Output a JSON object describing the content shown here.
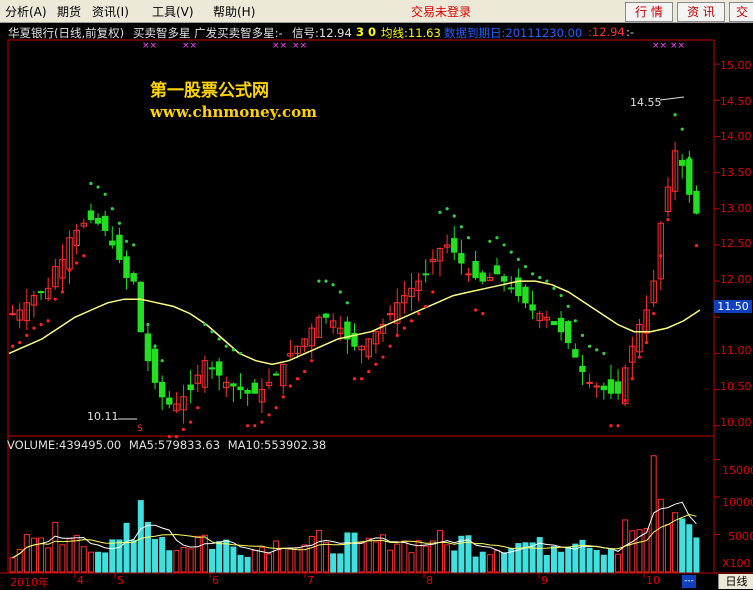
{
  "menu": {
    "items": [
      {
        "label": "分析(A)",
        "name": "menu-analysis"
      },
      {
        "label": "期货",
        "name": "menu-futures"
      },
      {
        "label": "资讯(I)",
        "name": "menu-info"
      },
      {
        "label": "工具(V)",
        "name": "menu-tools"
      },
      {
        "label": "帮助(H)",
        "name": "menu-help"
      }
    ],
    "trade_status": "交易未登录",
    "buttons": {
      "quotes": "行 情",
      "news": "资 讯",
      "trade": "交"
    }
  },
  "chart_header": {
    "stock": "华夏银行(日线,前复权)",
    "indicator": "买卖智多星  广发买卖智多星:-",
    "signal": "信号:12.94",
    "signal_flag": "3 0",
    "ma_line": "均线:11.63",
    "data_date": "数据到期日:20111230.00",
    "last_value": ":12.94",
    "tail": ":-",
    "marks": [
      "××",
      "××",
      "××",
      "××",
      "××",
      "××"
    ]
  },
  "watermark": {
    "title": "第一股票公式网",
    "url": "www.chnmoney.com"
  },
  "annotations": {
    "high": "14.55",
    "low": "10.11",
    "low_marker": "S"
  },
  "price_axis": {
    "ticks": [
      "15.00",
      "14.50",
      "14.00",
      "13.50",
      "13.00",
      "12.50",
      "12.00",
      "11.50",
      "11.00",
      "10.50",
      "10.00"
    ],
    "current": "11.50"
  },
  "volume_header": {
    "volume": "VOLUME:439495.00",
    "ma5": "MA5:579833.63",
    "ma10": "MA10:553902.38"
  },
  "volume_axis": {
    "ticks": [
      "15000",
      "10000",
      "5000"
    ],
    "unit": "X100"
  },
  "time_axis": {
    "labels": [
      "2010年",
      "4",
      "5",
      "6",
      "7",
      "8",
      "9",
      "10"
    ],
    "period_button": "日线",
    "end_marker": "---"
  },
  "colors": {
    "up": "#ff3030",
    "down": "#20e020",
    "ma": "#ffff80",
    "signal_up": "#ff2020",
    "signal_down": "#30d040",
    "axis": "#c00000",
    "accent": "#ffd400"
  },
  "chart_data": {
    "type": "candlestick",
    "price_range": [
      9.9,
      15.25
    ],
    "highlighted_high": 14.55,
    "highlighted_low": 10.11,
    "closes": [
      11.55,
      11.6,
      11.7,
      11.8,
      11.85,
      11.9,
      12.2,
      12.3,
      12.6,
      12.7,
      12.8,
      12.85,
      12.8,
      12.7,
      12.5,
      12.3,
      12.05,
      12.0,
      11.3,
      10.9,
      10.6,
      10.4,
      10.3,
      10.3,
      10.4,
      10.5,
      10.7,
      10.9,
      10.8,
      10.7,
      10.6,
      10.55,
      10.5,
      10.45,
      10.45,
      10.5,
      10.6,
      10.7,
      10.85,
      11.0,
      11.1,
      11.2,
      11.35,
      11.5,
      11.5,
      11.45,
      11.35,
      11.2,
      11.1,
      11.1,
      11.2,
      11.3,
      11.4,
      11.55,
      11.7,
      11.8,
      11.9,
      12.0,
      12.1,
      12.3,
      12.45,
      12.5,
      12.4,
      12.25,
      12.1,
      12.05,
      12.0,
      12.05,
      12.1,
      12.0,
      11.9,
      11.8,
      11.7,
      11.6,
      11.55,
      11.5,
      11.4,
      11.3,
      11.15,
      10.95,
      10.75,
      10.6,
      10.55,
      10.5,
      10.45,
      10.45,
      10.8,
      11.1,
      11.4,
      11.6,
      12.0,
      12.8,
      13.3,
      13.8,
      13.6,
      13.2,
      12.94
    ],
    "ma": [
      11.0,
      11.1,
      11.2,
      11.35,
      11.5,
      11.6,
      11.7,
      11.75,
      11.75,
      11.7,
      11.65,
      11.55,
      11.4,
      11.2,
      11.0,
      10.9,
      10.85,
      10.9,
      11.0,
      11.1,
      11.2,
      11.25,
      11.3,
      11.4,
      11.5,
      11.6,
      11.7,
      11.8,
      11.85,
      11.9,
      11.95,
      12.0,
      12.0,
      11.95,
      11.85,
      11.7,
      11.55,
      11.4,
      11.3,
      11.3,
      11.35,
      11.45,
      11.6
    ],
    "volume": {
      "max": 16000,
      "ma5_last": 579833.63,
      "ma10_last": 553902.38,
      "last": 439495.0
    }
  }
}
